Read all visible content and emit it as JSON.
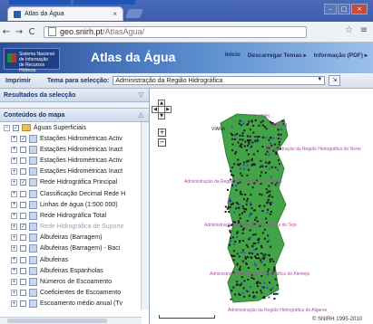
{
  "browser": {
    "tab_title": "Atlas da Água",
    "tab_close": "×",
    "url_host": "geo.snirh.pt",
    "url_path": "/AtlasAgua/",
    "back": "←",
    "forward": "→",
    "reload": "C",
    "star": "☆",
    "menu": "≡"
  },
  "banner": {
    "logo_line1": "Sistema Nacional",
    "logo_line2": "de Informação",
    "logo_line3": "de Recursos Hídricos",
    "title": "Atlas da Água",
    "links": [
      "Início",
      "Descarregar Temas ▸",
      "Informação (PDF) ▸"
    ]
  },
  "toolbar": {
    "print": "Imprimir",
    "theme_label": "Tema para selecção:",
    "theme_value": "Administração da Região Hidrográfica"
  },
  "left": {
    "results_header": "Resultados da selecção",
    "contents_header": "Conteúdos do mapa",
    "root_label": "Águas Superficiais",
    "layers": [
      {
        "label": "Estações Hidrométricas Activ",
        "checked": true
      },
      {
        "label": "Estações Hidrométricas Inact",
        "checked": false
      },
      {
        "label": "Estações Hidrométricas Activ",
        "checked": false
      },
      {
        "label": "Estações Hidrométricas Inact",
        "checked": false
      },
      {
        "label": "Rede Hidrográfica Principal",
        "checked": true
      },
      {
        "label": "Classificação Decimal Rede H",
        "checked": false
      },
      {
        "label": "Linhas de água (1:500 000)",
        "checked": false
      },
      {
        "label": "Rede Hidrográfica Total",
        "checked": false
      },
      {
        "label": "Rede Hidrográfica de Suporte",
        "checked": true
      },
      {
        "label": "Albufeiras (Barragem)",
        "checked": false
      },
      {
        "label": "Albufeiras (Barragem) - Baci",
        "checked": false
      },
      {
        "label": "Albufeiras",
        "checked": false
      },
      {
        "label": "Albufeiras Espanholas",
        "checked": false
      },
      {
        "label": "Números de Escoamento",
        "checked": false
      },
      {
        "label": "Coeficientes de Escoamento",
        "checked": false
      },
      {
        "label": "Escoamento médio anual (Tv",
        "checked": false
      }
    ]
  },
  "map": {
    "copyright": "© SNIRH 1995-2010",
    "labels": [
      "VIANA",
      "01H/03H",
      "03F/03H",
      "Administração da Região Hidrográfica do Norte",
      "Administração da Região Hidrográfica do Centro",
      "Administração da Região Hidrográfica do Tejo",
      "Administração da Região Hidrográfica do Alentejo",
      "Administração da Região Hidrográfica do Algarve"
    ],
    "colors": {
      "stations": "#1a1a1a",
      "land": "#3c9a3c",
      "label": "#c040c0",
      "river": "#2a52c8"
    }
  }
}
